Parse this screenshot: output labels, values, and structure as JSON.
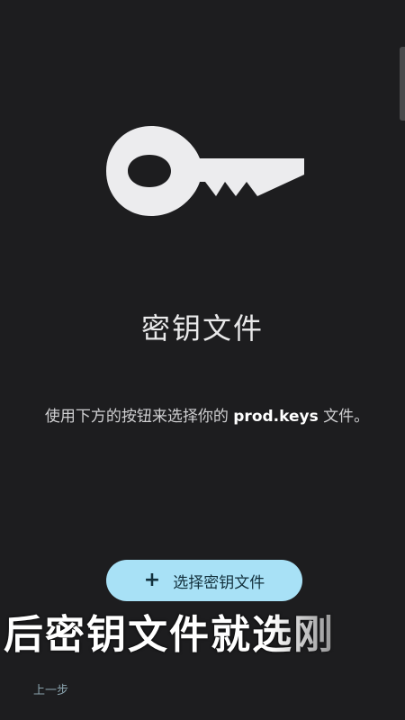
{
  "screen": {
    "title": "密钥文件",
    "description_prefix": "使用下方的按钮来选择你的 ",
    "description_filename": "prod.keys",
    "description_suffix": " 文件。",
    "icon": "key-icon"
  },
  "actions": {
    "select_button_icon": "+",
    "select_button_label": "选择密钥文件",
    "back_label": "上一步"
  },
  "overlay": {
    "caption": "后密钥文件就选刚"
  },
  "colors": {
    "background": "#1d1d1f",
    "button": "#a8e1f6",
    "button_text": "#12303c"
  }
}
